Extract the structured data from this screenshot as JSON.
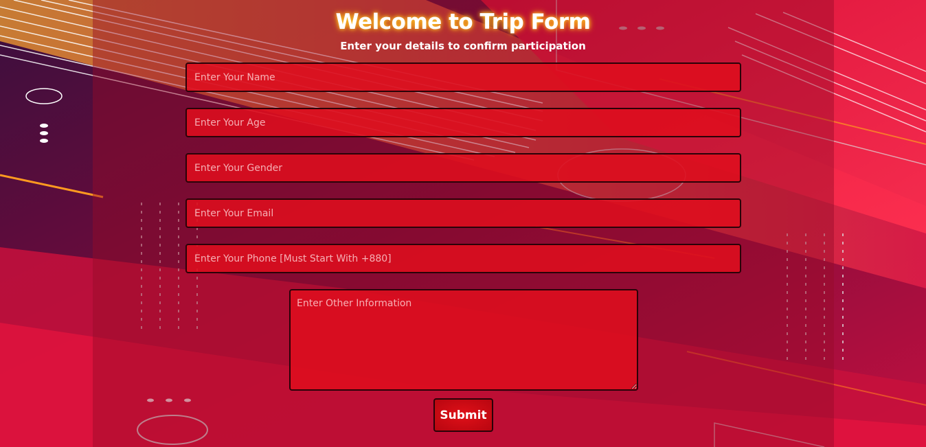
{
  "form": {
    "title": "Welcome to Trip Form",
    "subtitle": "Enter your details to confirm participation",
    "fields": [
      {
        "placeholder": "Enter Your Name",
        "value": ""
      },
      {
        "placeholder": "Enter Your Age",
        "value": ""
      },
      {
        "placeholder": "Enter Your Gender",
        "value": ""
      },
      {
        "placeholder": "Enter Your Email",
        "value": ""
      },
      {
        "placeholder": "Enter Your Phone [Must Start With +880]",
        "value": ""
      }
    ],
    "other_info": {
      "placeholder": "Enter Other Information",
      "value": ""
    },
    "submit_label": "Submit"
  },
  "colors": {
    "field_bg": "#de0e1e",
    "field_border": "#2a0208",
    "title_glow": "#ffcc33",
    "bg_primary": "#6a0c3a",
    "bg_accent": "#e8123a"
  }
}
